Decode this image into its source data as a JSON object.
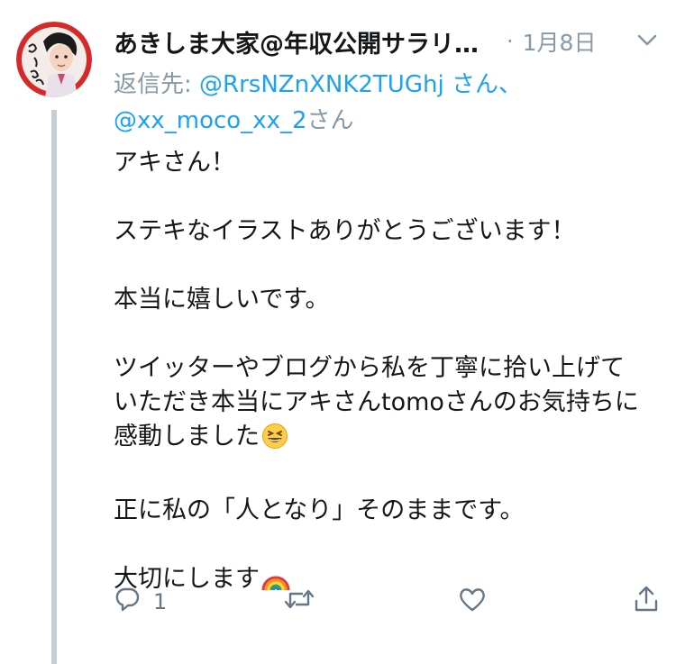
{
  "tweet": {
    "display_name": "あきしま大家@年収公開サラリーマン大家",
    "dot": "·",
    "date": "1月8日",
    "reply_prefix": "返信先: ",
    "reply_user_1": "@RrsNZnXNK2TUGhj",
    "reply_suffix_1": " さん、",
    "reply_user_2": "@xx_moco_xx_2",
    "reply_suffix_2": "さん",
    "lines": [
      "アキさん！",
      "",
      "ステキなイラストありがとうございます！",
      "",
      "本当に嬉しいです。",
      "",
      "ツイッターやブログから私を丁寧に拾い上げて",
      "いただき本当にアキさんtomoさんのお気持ちに",
      "感動しました",
      "",
      "正に私の「人となり」そのままです。",
      "",
      "大切にします"
    ],
    "reply_count": "1",
    "retweet_count": "",
    "like_count": ""
  },
  "icons": {
    "avatar": "avatar-portrait",
    "caret": "chevron-down-icon",
    "reply": "reply-icon",
    "retweet": "retweet-icon",
    "like": "heart-icon",
    "share": "share-icon",
    "emoji_laugh": "grinning-squinting-face-emoji",
    "emoji_rainbow": "rainbow-emoji"
  },
  "colors": {
    "link": "#1da1f2",
    "muted": "#8899a6",
    "text": "#14171a",
    "thread_line": "#c4ced6"
  }
}
